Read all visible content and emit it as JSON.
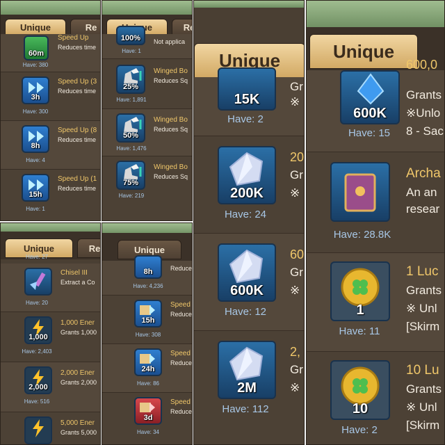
{
  "panels": {
    "p1": {
      "tab_active": "Unique",
      "tab_other": "Re",
      "rows": [
        {
          "name": "Speed Up",
          "desc": "Reduces time",
          "badge": "60m",
          "have": "Have: 380"
        },
        {
          "name": "Speed Up (3",
          "desc": "Reduces time",
          "badge": "3h",
          "have": "Have: 300"
        },
        {
          "name": "Speed Up (8",
          "desc": "Reduces time",
          "badge": "8h",
          "have": "Have: 4"
        },
        {
          "name": "Speed Up (1",
          "desc": "Reduces time",
          "badge": "15h",
          "have": "Have: 1"
        }
      ]
    },
    "p2": {
      "tab_active": "Unique",
      "tab_other": "Re",
      "rows": [
        {
          "name": "",
          "desc": "Not applica",
          "badge": "100%",
          "have": "Have: 1"
        },
        {
          "name": "Winged Bo",
          "desc": "Reduces Sq",
          "badge": "25%",
          "have": "Have: 1,891"
        },
        {
          "name": "Winged Bo",
          "desc": "Reduces Sq",
          "badge": "50%",
          "have": "Have: 1,476"
        },
        {
          "name": "Winged Bo",
          "desc": "Reduces Sq",
          "badge": "75%",
          "have": "Have: 219"
        }
      ]
    },
    "p3": {
      "tab_active": "Unique",
      "rows": [
        {
          "name": "",
          "desc": "Gr",
          "note": "※",
          "badge": "15K",
          "have": "Have: 2"
        },
        {
          "name": "20",
          "desc": "Gr",
          "note": "※",
          "badge": "200K",
          "have": "Have: 24"
        },
        {
          "name": "60",
          "desc": "Gr",
          "note": "※",
          "badge": "600K",
          "have": "Have: 12"
        },
        {
          "name": "2,",
          "desc": "Gr",
          "note": "※",
          "badge": "2M",
          "have": "Have: 112"
        }
      ]
    },
    "p4": {
      "tab_active": "Unique",
      "rows": [
        {
          "name": "600,0",
          "desc": "Grants",
          "note": "※Unlo",
          "extra": "8 - Sac",
          "badge": "600K",
          "have": "Have: 15"
        },
        {
          "name": "Archa",
          "desc": "An an",
          "note": "resear",
          "extra": "",
          "badge": "",
          "have": "Have: 28.8K"
        },
        {
          "name": "1 Luc",
          "desc": "Grants",
          "note": "※ Unl",
          "extra": "[Skirm",
          "badge": "1",
          "have": "Have: 11"
        },
        {
          "name": "10 Lu",
          "desc": "Grants",
          "note": "※ Unl",
          "extra": "[Skirm",
          "badge": "10",
          "have": "Have: 2"
        }
      ]
    },
    "p5": {
      "tab_active": "Unique",
      "tab_other": "Re",
      "top_have": "Have: 27",
      "rows": [
        {
          "name": "Chisel III",
          "desc": "Extract a Co",
          "badge": "",
          "have": "Have: 20"
        },
        {
          "name": "1,000 Ener",
          "desc": "Grants 1,000",
          "badge": "1,000",
          "have": "Have: 2,403"
        },
        {
          "name": "2,000 Ener",
          "desc": "Grants 2,000",
          "badge": "2,000",
          "have": "Have: 516"
        },
        {
          "name": "5,000 Ener",
          "desc": "Grants 5,000",
          "badge": "",
          "have": ""
        }
      ]
    },
    "p6": {
      "tab_active": "Unique",
      "rows": [
        {
          "name": "",
          "desc": "Reduce",
          "badge": "8h",
          "have": "Have: 4,236"
        },
        {
          "name": "Speed",
          "desc": "Reduce",
          "badge": "15h",
          "have": "Have: 308"
        },
        {
          "name": "Speed",
          "desc": "Reduce",
          "badge": "24h",
          "have": "Have: 86"
        },
        {
          "name": "Speed",
          "desc": "Reduce",
          "badge": "3d",
          "have": "Have: 34"
        }
      ]
    }
  }
}
